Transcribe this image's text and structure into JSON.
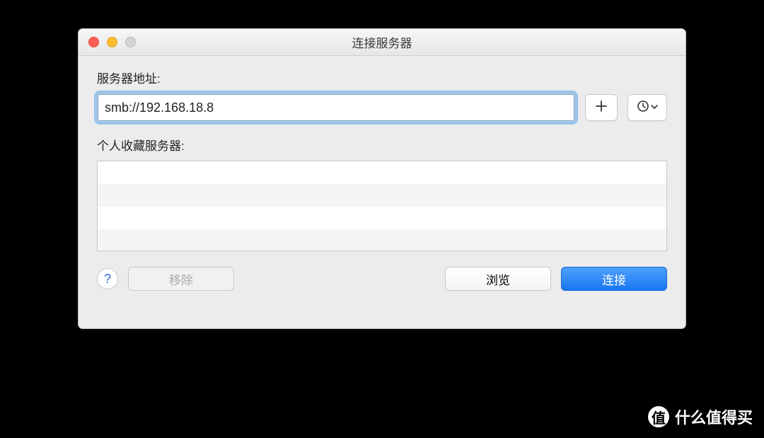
{
  "window": {
    "title": "连接服务器"
  },
  "address": {
    "label": "服务器地址:",
    "value": "smb://192.168.18.8"
  },
  "favorites": {
    "label": "个人收藏服务器:",
    "items": []
  },
  "buttons": {
    "help": "?",
    "remove": "移除",
    "browse": "浏览",
    "connect": "连接"
  },
  "watermark": {
    "badge": "值",
    "text": "什么值得买"
  }
}
